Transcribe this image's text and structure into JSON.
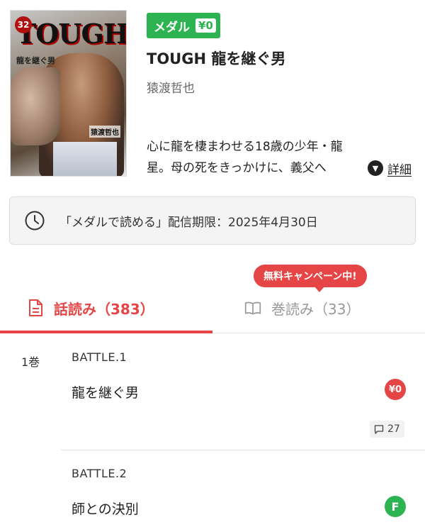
{
  "cover": {
    "volume_number": "32",
    "logo_text": "TOUGH",
    "subtitle": "龍を継ぐ男",
    "author_text": "猿渡哲也"
  },
  "book": {
    "medal_label": "メダル",
    "medal_price": "¥0",
    "title": "TOUGH 龍を継ぐ男",
    "author": "猿渡哲也",
    "description_line1": "心に龍を棲まわせる18歳の少年・龍",
    "description_line2": "星。母の死をきっかけに、義父へ",
    "detail_label": "詳細",
    "detail_icon": "chevron-down-icon"
  },
  "notice": {
    "icon": "clock-icon",
    "text": "「メダルで読める」配信期限：2025年4月30日"
  },
  "campaign_badge": "無料キャンペーン中!",
  "tabs": [
    {
      "label": "話読み（383）",
      "icon": "document-icon",
      "active": true
    },
    {
      "label": "巻読み（33）",
      "icon": "book-icon",
      "active": false
    }
  ],
  "volume_label": "1巻",
  "episodes": [
    {
      "name": "BATTLE.1",
      "title": "龍を継ぐ男",
      "badge": "¥0",
      "badge_color": "#e64545",
      "comments": "27"
    },
    {
      "name": "BATTLE.2",
      "title": "師との決別",
      "badge": "F",
      "badge_color": "#2db352"
    }
  ],
  "colors": {
    "accent_red": "#e64545",
    "medal_green": "#2db352"
  }
}
